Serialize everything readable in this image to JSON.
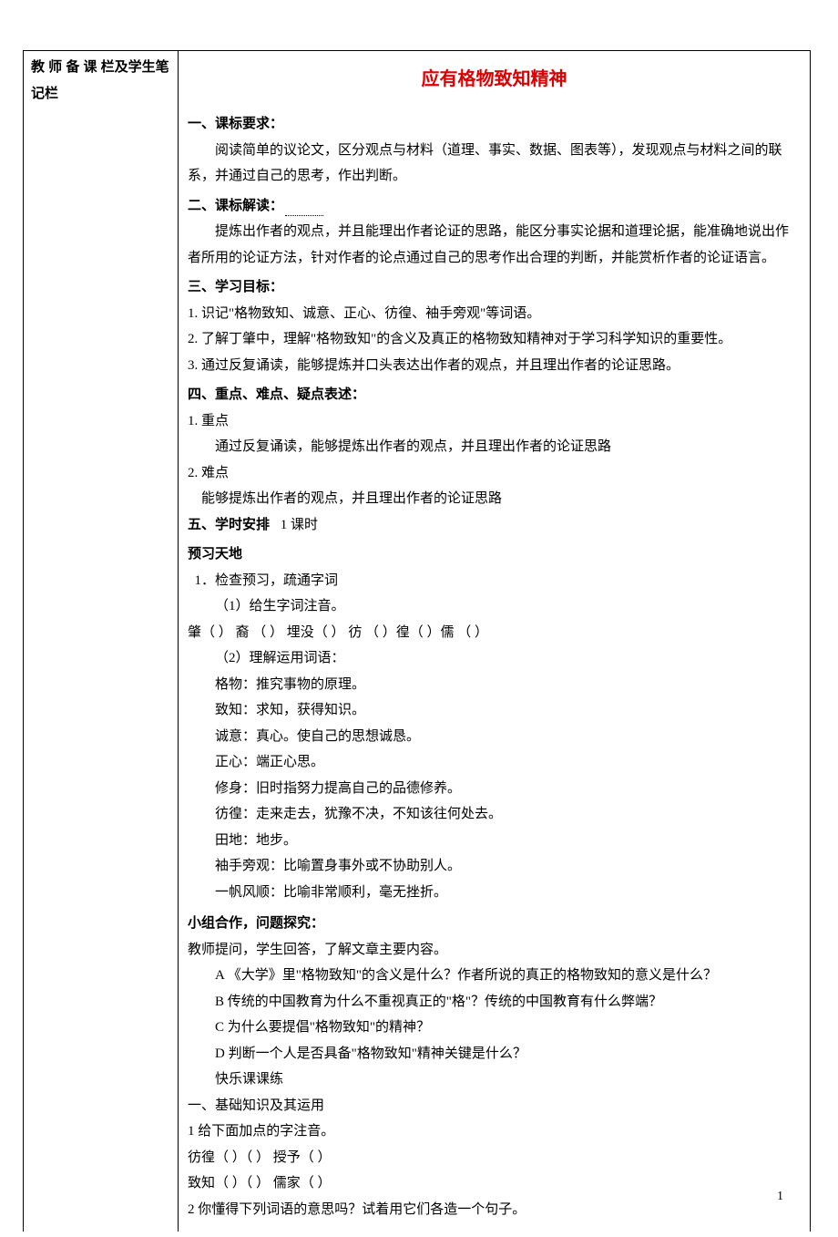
{
  "sidebar": {
    "label": "教 师 备 课 栏及学生笔记栏"
  },
  "title": "应有格物致知精神",
  "sections": {
    "s1": {
      "head": "一、课标要求：",
      "p1": "阅读简单的议论文，区分观点与材料（道理、事实、数据、图表等），发现观点与材料之间的联系，并通过自己的思考，作出判断。"
    },
    "s2": {
      "head": "二、课标解读：",
      "p1": "提炼出作者的观点，并且能理出作者论证的思路，能区分事实论据和道理论据，能准确地说出作者所用的论证方法，针对作者的论点通过自己的思考作出合理的判断，并能赏析作者的论证语言。"
    },
    "s3": {
      "head": "三、学习目标：",
      "i1": "1. 识记\"格物致知、诚意、正心、彷徨、袖手旁观\"等词语。",
      "i2": "2. 了解丁肇中，理解\"格物致知\"的含义及真正的格物致知精神对于学习科学知识的重要性。",
      "i3": "3. 通过反复诵读，能够提炼并口头表达出作者的观点，并且理出作者的论证思路。"
    },
    "s4": {
      "head": "四、重点、难点、疑点表述：",
      "l1": "1. 重点",
      "p1": "通过反复诵读，能够提炼出作者的观点，并且理出作者的论证思路",
      "l2": "2. 难点",
      "p2": "能够提炼出作者的观点，并且理出作者的论证思路"
    },
    "s5": {
      "head": "五、学时安排",
      "value": "1 课时"
    },
    "preview": {
      "head": "预习天地",
      "i1": "1．检查预习，疏通字词",
      "sub1": "（1）给生字词注音。",
      "line_pinyin": "肇（  ）  裔 （  ）   埋没（  ）   彷 （  ）徨（  ）儒 （  ）",
      "sub2": "（2）理解运用词语：",
      "w1": "格物：推究事物的原理。",
      "w2": "致知：求知，获得知识。",
      "w3": "诚意：真心。使自己的思想诚恳。",
      "w4": "正心：端正心思。",
      "w5": "修身：旧时指努力提高自己的品德修养。",
      "w6": "彷徨：走来走去，犹豫不决，不知该往何处去。",
      "w7": "田地：地步。",
      "w8": "袖手旁观：比喻置身事外或不协助别人。",
      "w9": "一帆风顺：比喻非常顺利，毫无挫折。"
    },
    "group": {
      "head": "小组合作，问题探究：",
      "intro": "教师提问，学生回答，了解文章主要内容。",
      "qa": "A 《大学》里\"格物致知\"的含义是什么？作者所说的真正的格物致知的意义是什么？",
      "qb": "B 传统的中国教育为什么不重视真正的\"格\"？传统的中国教育有什么弊端？",
      "qc": "C 为什么要提倡\"格物致知\"的精神？",
      "qd": "D 判断一个人是否具备\"格物致知\"精神关键是什么？",
      "kl": "快乐课课练"
    },
    "basics": {
      "head": "一、基础知识及其运用",
      "i1": "1  给下面加点的字注音。",
      "line1": "彷徨（      ）（      ）  授予（      ）",
      "line2": "致知（      ）（      ）  儒家（      ）",
      "i2": "2  你懂得下列词语的意思吗？试着用它们各造一个句子。"
    }
  },
  "page_number": "1"
}
